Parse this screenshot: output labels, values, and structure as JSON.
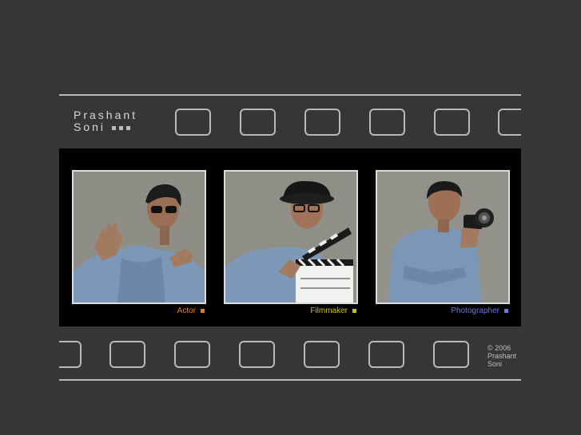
{
  "brand": {
    "first": "Prashant",
    "last": "Soni"
  },
  "photos": [
    {
      "caption": "Actor",
      "color": "#e07b22"
    },
    {
      "caption": "Filmmaker",
      "color": "#c9c21a"
    },
    {
      "caption": "Photographer",
      "color": "#6b74e8"
    }
  ],
  "copyright": {
    "line1": "© 2006",
    "line2": "Prashant",
    "line3": "Soni"
  }
}
